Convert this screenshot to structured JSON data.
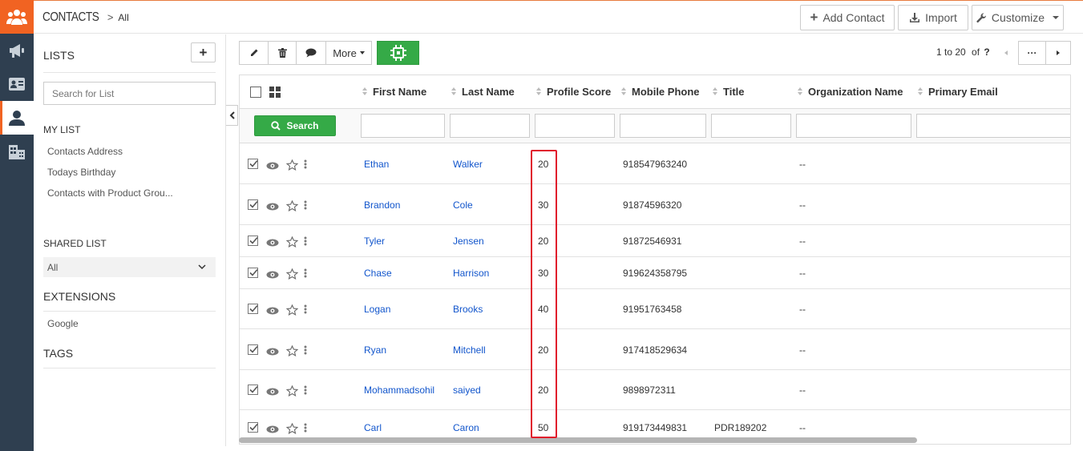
{
  "header": {
    "module": "CONTACTS",
    "separator": ">",
    "current": "All",
    "add_contact": "Add Contact",
    "import": "Import",
    "customize": "Customize"
  },
  "sidebar": {
    "lists_title": "LISTS",
    "search_placeholder": "Search for List",
    "my_list_title": "MY LIST",
    "my_list_items": [
      "Contacts Address",
      "Todays Birthday",
      "Contacts with Product Grou..."
    ],
    "shared_list_title": "SHARED LIST",
    "shared_list_value": "All",
    "extensions_title": "EXTENSIONS",
    "extensions_items": [
      "Google"
    ],
    "tags_title": "TAGS"
  },
  "toolbar": {
    "more_label": "More"
  },
  "pager": {
    "range": "1 to 20",
    "of_label": "of",
    "total": "?",
    "more_dots": "···"
  },
  "table": {
    "columns": [
      "First Name",
      "Last Name",
      "Profile Score",
      "Mobile Phone",
      "Title",
      "Organization Name",
      "Primary Email"
    ],
    "search_label": "Search",
    "rows": [
      {
        "first": "Ethan",
        "last": "Walker",
        "score": "20",
        "phone": "918547963240",
        "title": "",
        "org": "--"
      },
      {
        "first": "Brandon",
        "last": "Cole",
        "score": "30",
        "phone": "91874596320",
        "title": "",
        "org": "--"
      },
      {
        "first": "Tyler",
        "last": "Jensen",
        "score": "20",
        "phone": "91872546931",
        "title": "",
        "org": "--"
      },
      {
        "first": "Chase",
        "last": "Harrison",
        "score": "30",
        "phone": "919624358795",
        "title": "",
        "org": "--"
      },
      {
        "first": "Logan",
        "last": "Brooks",
        "score": "40",
        "phone": "91951763458",
        "title": "",
        "org": "--"
      },
      {
        "first": "Ryan",
        "last": "Mitchell",
        "score": "20",
        "phone": "917418529634",
        "title": "",
        "org": "--"
      },
      {
        "first": "Mohammadsohil",
        "last": "saiyed",
        "score": "20",
        "phone": "9898972311",
        "title": "",
        "org": "--"
      },
      {
        "first": "Carl",
        "last": "Caron",
        "score": "50",
        "phone": "919173449831",
        "title": "PDR189202",
        "org": "--"
      }
    ]
  },
  "colors": {
    "brand_orange": "#f16322",
    "rail_bg": "#2f3f50",
    "green": "#35aa47",
    "link_blue": "#1155cc",
    "highlight_red": "#e0182c"
  }
}
